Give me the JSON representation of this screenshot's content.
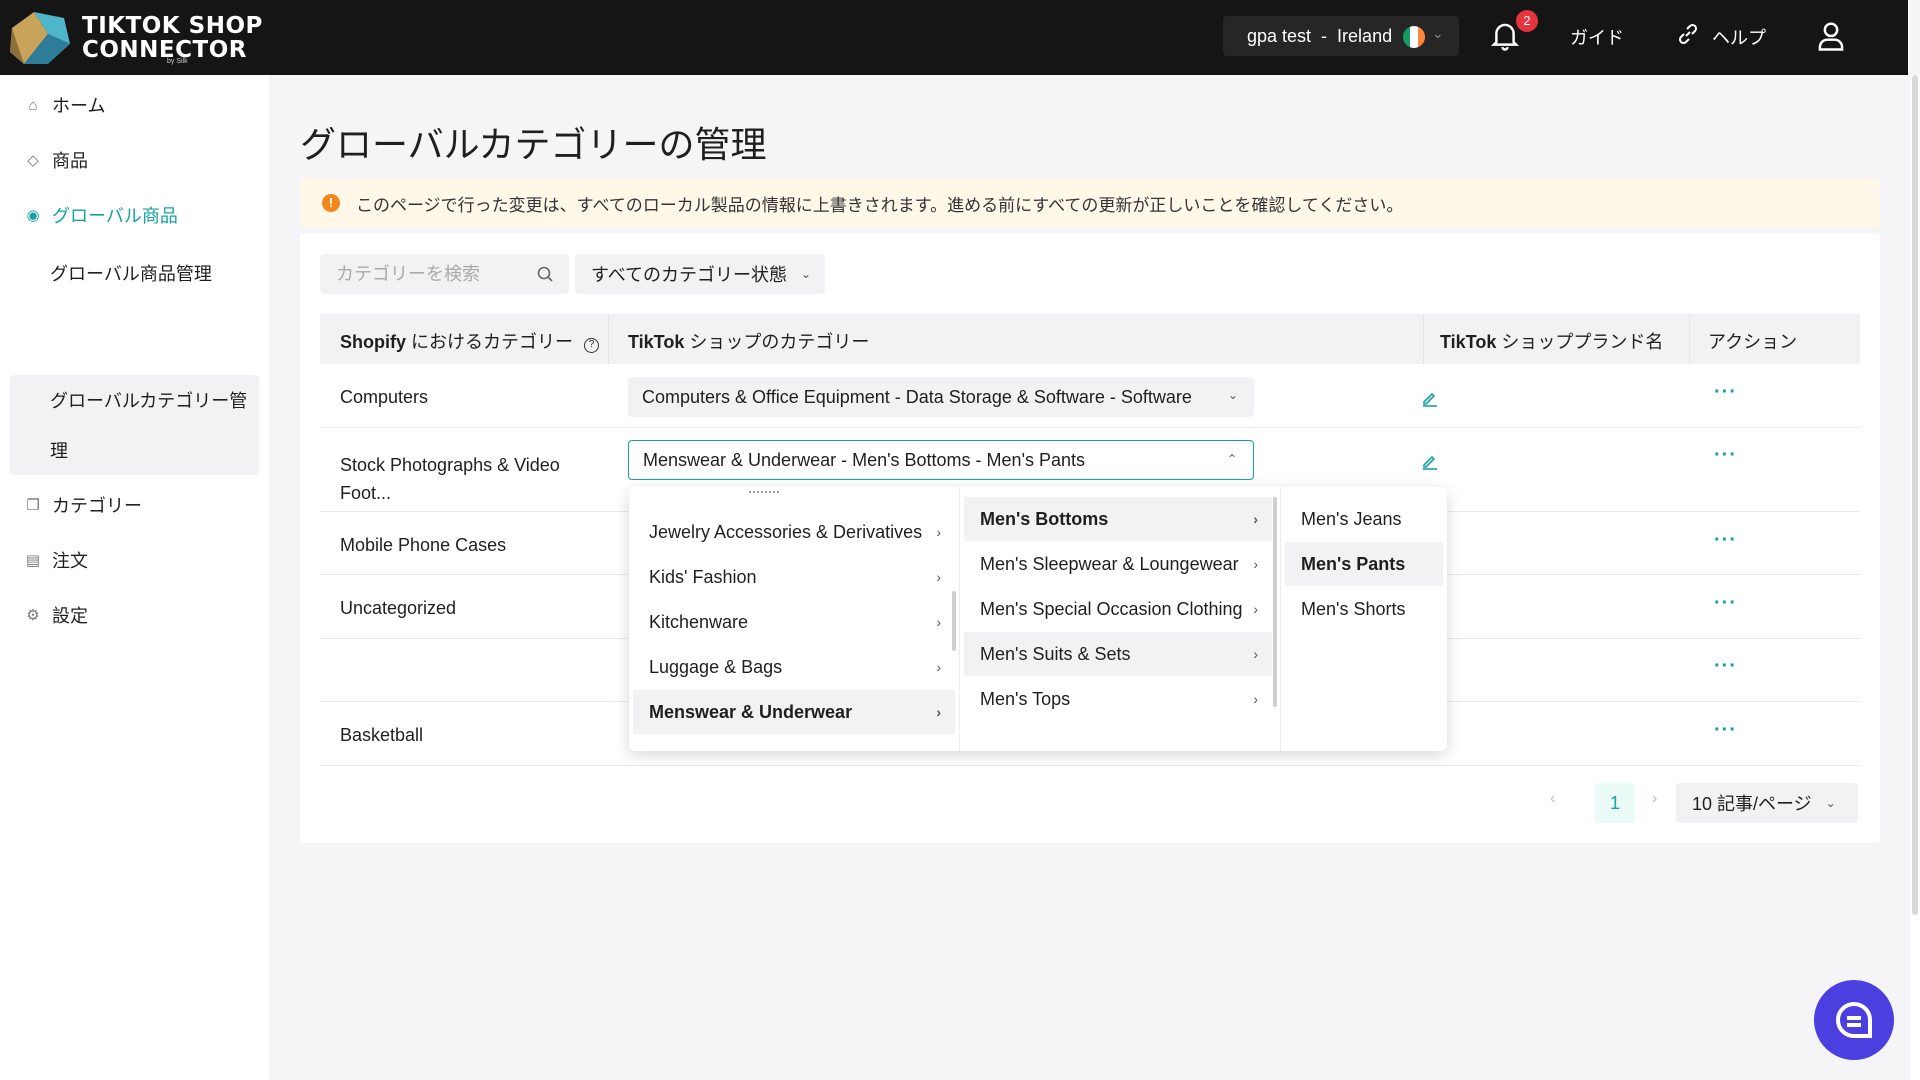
{
  "app": {
    "logo_line1": "TIKTOK SHOP",
    "logo_line2": "CONNECTOR",
    "logo_sub": "by Silk"
  },
  "topbar": {
    "store_name": "gpa test",
    "store_sep": "-",
    "store_country": "Ireland",
    "notification_count": "2",
    "guide_label": "ガイド",
    "help_label": "ヘルプ"
  },
  "sidebar": {
    "items": [
      {
        "label": "ホーム",
        "icon": "home-icon"
      },
      {
        "label": "商品",
        "icon": "tag-icon"
      },
      {
        "label": "グローバル商品",
        "icon": "globe-icon"
      },
      {
        "label": "カテゴリー",
        "icon": "copy-icon"
      },
      {
        "label": "注文",
        "icon": "shopping-bag-icon"
      },
      {
        "label": "設定",
        "icon": "gear-icon"
      }
    ],
    "sub_items": [
      {
        "label": "グローバル商品管理"
      },
      {
        "label_line1": "グローバルカテゴリー管",
        "label_line2": "理"
      }
    ]
  },
  "main": {
    "title": "グローバルカテゴリーの管理",
    "alert": "このページで行った変更は、すべてのローカル製品の情報に上書きされます。進める前にすべての更新が正しいことを確認してください。",
    "search_placeholder": "カテゴリーを検索",
    "filter_label": "すべてのカテゴリー状態",
    "columns": {
      "shopify_bold": "Shopify",
      "shopify_rest": " におけるカテゴリー",
      "tiktok_bold": "TikTok",
      "tiktok_rest": " ショップのカテゴリー",
      "brand_bold": "TikTok",
      "brand_rest": " ショッププランド名",
      "action": "アクション"
    },
    "rows": [
      {
        "shopify": "Computers",
        "tiktok": "Computers & Office Equipment - Data Storage & Software - Software"
      },
      {
        "shopify_line1": "Stock Photographs & Video",
        "shopify_line2": "Foot...",
        "tiktok": "Menswear & Underwear - Men's Bottoms - Men's Pants"
      },
      {
        "shopify": "Mobile Phone Cases"
      },
      {
        "shopify": "Uncategorized"
      },
      {
        "shopify": ""
      },
      {
        "shopify": "Basketball"
      }
    ],
    "action_label": "···",
    "pagination": {
      "current_page": "1",
      "page_size": "10 記事/ページ"
    }
  },
  "cascader": {
    "col1": [
      "Jewelry Accessories & Derivatives",
      "Kids' Fashion",
      "Kitchenware",
      "Luggage & Bags",
      "Menswear & Underwear"
    ],
    "col2": [
      "Men's Bottoms",
      "Men's Sleepwear & Loungewear",
      "Men's Special Occasion Clothing",
      "Men's Suits & Sets",
      "Men's Tops"
    ],
    "col3": [
      "Men's Jeans",
      "Men's Pants",
      "Men's Shorts"
    ]
  },
  "colors": {
    "accent": "#17a2a2",
    "topbar": "#151515",
    "chat": "#4c3fe0",
    "badge": "#e8343f",
    "alert_bg": "#fff8e8"
  }
}
